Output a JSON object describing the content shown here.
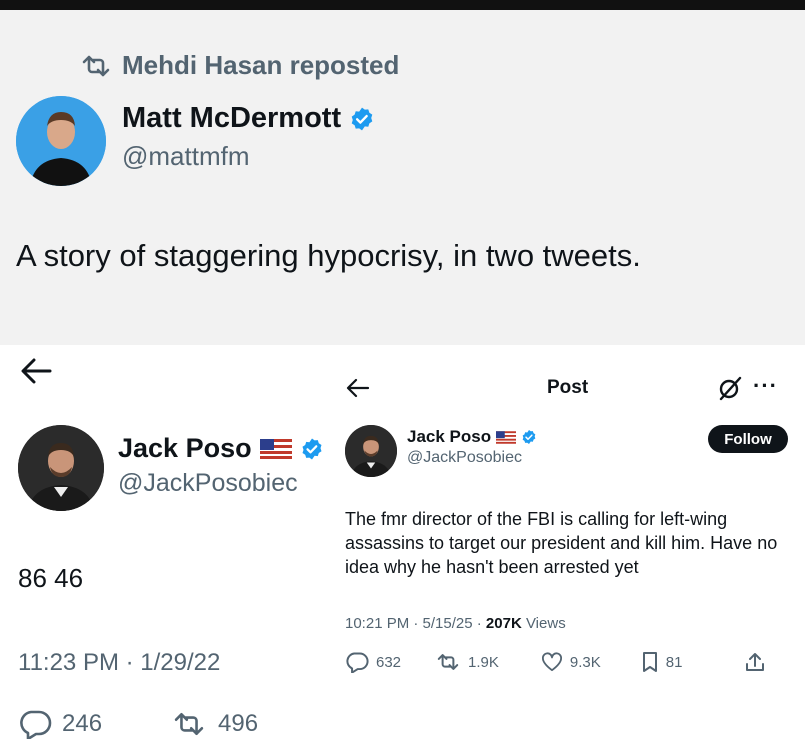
{
  "outer_tweet": {
    "repost_text": "Mehdi Hasan reposted",
    "author_name": "Matt McDermott",
    "author_handle": "@mattmfm",
    "text": "A story of staggering hypocrisy, in two tweets."
  },
  "left_tweet": {
    "name": "Jack Poso",
    "handle": "@JackPosobiec",
    "text": "86 46",
    "timestamp": "11:23 PM · 1/29/22",
    "replies": "246",
    "reposts": "496"
  },
  "right_tweet": {
    "header_title": "Post",
    "name": "Jack Poso",
    "handle": "@JackPosobiec",
    "follow_label": "Follow",
    "text": "The fmr director of the FBI is calling for left-wing assassins to target our president and kill him. Have no idea why he hasn't been arrested yet",
    "time": "10:21 PM · 5/15/25 · ",
    "views_count": "207K",
    "views_label": " Views",
    "replies": "632",
    "reposts": "1.9K",
    "likes": "9.3K",
    "bookmarks": "81"
  },
  "icons": {
    "repost": "repost-icon",
    "verified": "verified-badge-icon",
    "flag": "us-flag-icon",
    "back": "back-arrow-icon",
    "grok": "grok-icon",
    "more": "more-icon",
    "reply": "reply-icon",
    "like": "like-icon",
    "bookmark": "bookmark-icon",
    "share": "share-icon"
  },
  "colors": {
    "verified_blue": "#1d9bf0",
    "muted_text": "#536471",
    "primary_text": "#0f1419"
  }
}
